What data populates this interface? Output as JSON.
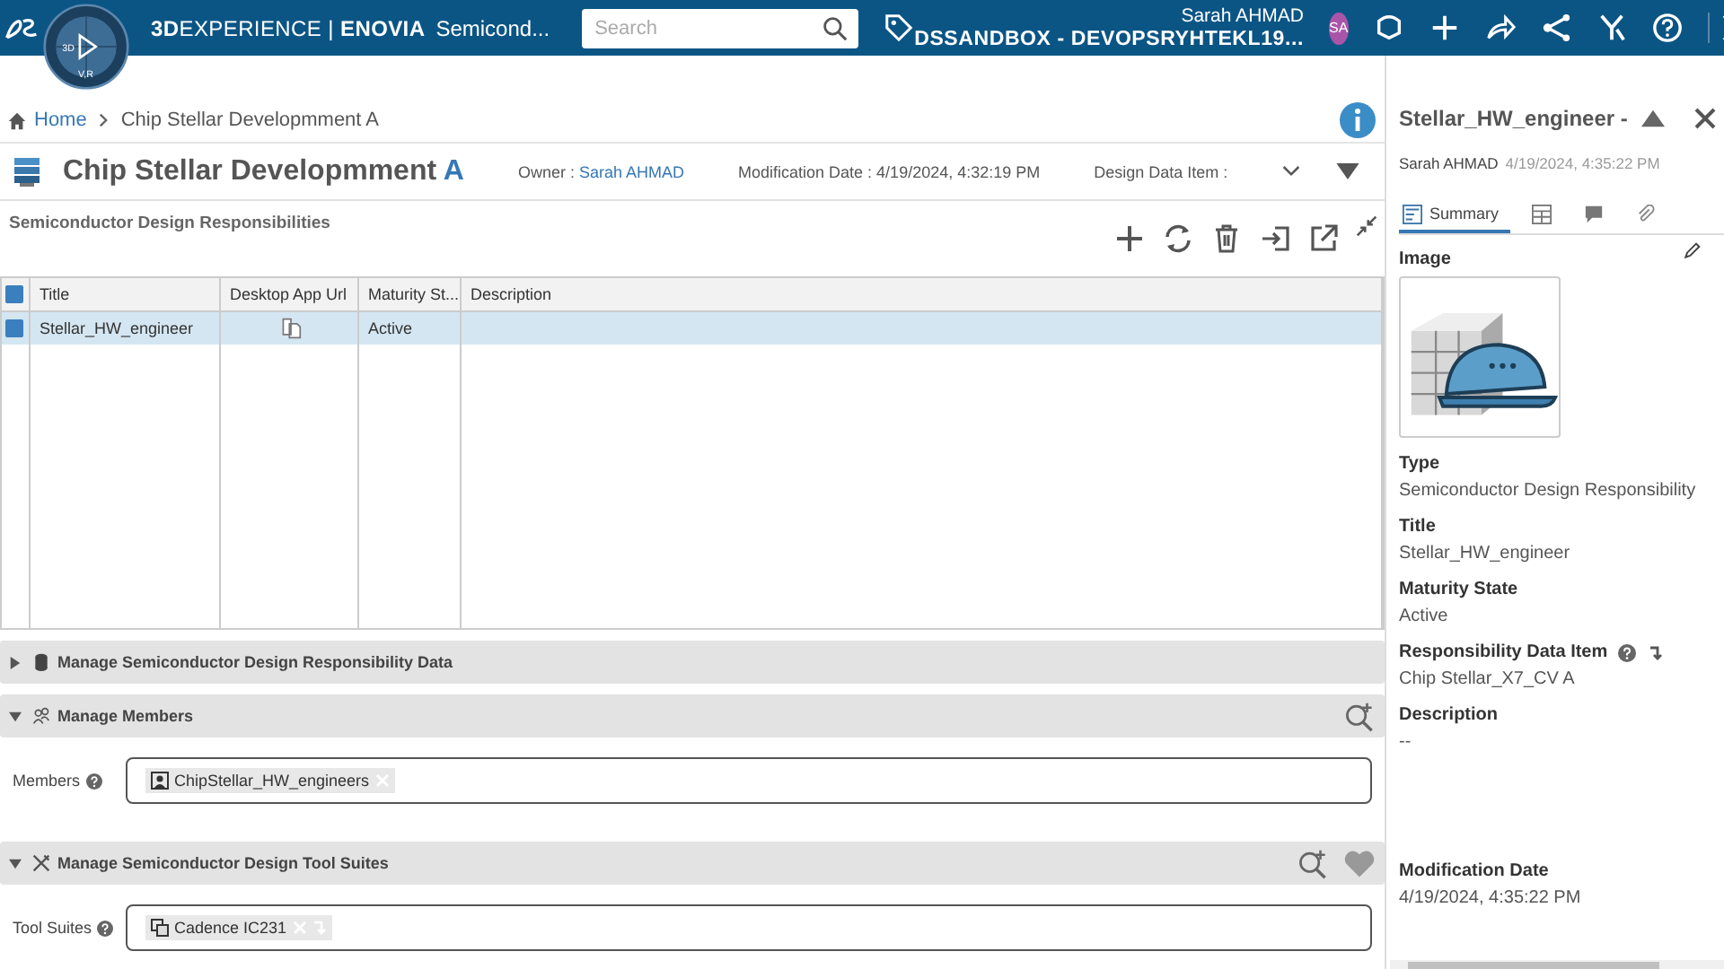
{
  "topbar": {
    "compass_labels": [
      "3D",
      "V,R"
    ],
    "brand": "**3D**EXPERIENCE | **ENOVIA**",
    "app": "Semicond...",
    "search": {
      "placeholder": "Search"
    },
    "user": "Sarah AHMAD",
    "tenant": "DSSANDBOX - DEVOPSRYHTEKL19...",
    "avatar": "SA"
  },
  "breadcrumb": [
    "Home",
    "Chip Stellar Developmment A"
  ],
  "header": {
    "title": "Chip Stellar Developmment",
    "revision": "A",
    "owner_label": "Owner :",
    "owner": "Sarah AHMAD",
    "date_label": "Modification Date :",
    "date": "4/19/2024, 4:32:19 PM",
    "item_label": "Design Data Item :"
  },
  "section_title": "Semiconductor Design Responsibilities",
  "table": {
    "all_checked": true,
    "columns": [
      "Title",
      "Desktop App Url",
      "Maturity St...",
      "Description"
    ],
    "rows": [
      {
        "checked": true,
        "selected": true,
        "title": "Stellar_HW_engineer",
        "state": "Active"
      }
    ]
  },
  "sections": [
    {
      "label": "Manage Semiconductor Design Responsibility Data",
      "expanded": false
    },
    {
      "label": "Manage Members",
      "expanded": true,
      "field": {
        "label": "Members",
        "chips": [
          "ChipStellar_HW_engineers"
        ]
      }
    },
    {
      "label": "Manage Semiconductor Design Tool Suites",
      "expanded": true,
      "field": {
        "label": "Tool Suites",
        "chips": [
          "Cadence IC231"
        ]
      }
    }
  ],
  "panel": {
    "title": "Stellar_HW_engineer -",
    "owner": "Sarah AHMAD",
    "date": "4/19/2024, 4:35:22 PM",
    "tabs": [
      {
        "kind": "summary",
        "label": "Summary",
        "selected": true
      },
      {
        "kind": "table",
        "selected": false
      },
      {
        "kind": "comments",
        "selected": false
      },
      {
        "kind": "attachments",
        "selected": false
      }
    ],
    "fields": [
      {
        "kind": "picture",
        "label": "Image"
      },
      {
        "label": "Type",
        "value": "Semiconductor Design Responsibility"
      },
      {
        "label": "Title",
        "value": "Stellar_HW_engineer"
      },
      {
        "label": "Maturity State",
        "value": "Active"
      },
      {
        "label": "Responsibility Data Item",
        "value": "Chip Stellar_X7_CV A",
        "help": true
      },
      {
        "label": "Description",
        "value": "--"
      },
      {
        "label": "Modification Date",
        "value": "4/19/2024, 4:35:22 PM"
      }
    ]
  }
}
